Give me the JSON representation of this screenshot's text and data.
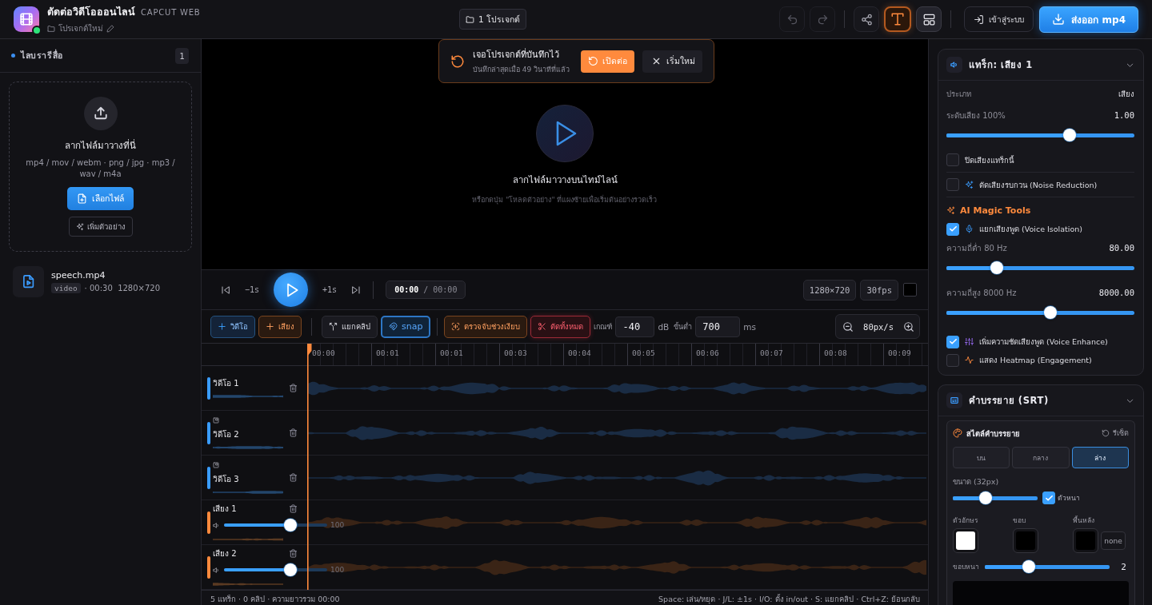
{
  "app": {
    "title": "ตัดต่อวิดีโอออนไลน์",
    "subtitle": "CAPCUT WEB",
    "project_name": "โปรเจกต์ใหม่",
    "online": true
  },
  "projects_button": "1 โปรเจกต์",
  "header_tools": [
    {
      "disabled": true,
      "selected": false,
      "pressed": false
    },
    {
      "disabled": true,
      "selected": false,
      "pressed": false
    },
    {
      "disabled": false,
      "selected": false,
      "pressed": false
    },
    {
      "disabled": false,
      "selected": true,
      "pressed": false
    },
    {
      "disabled": false,
      "selected": false,
      "pressed": true
    }
  ],
  "login_button": "เข้าสู่ระบบ",
  "export_button": "ส่งออก mp4",
  "library": {
    "title": "ไลบรารีสื่อ",
    "count": "1",
    "dropzone": {
      "title": "ลากไฟล์มาวางที่นี่",
      "formats": "mp4 / mov / webm · png / jpg · mp3 / wav / m4a",
      "choose_button": "เลือกไฟล์",
      "sample_button": "เพิ่มตัวอย่าง"
    },
    "items": [
      {
        "name": "speech.mp4",
        "type": "video",
        "details": "· 00:30  1280×720"
      }
    ]
  },
  "restore_banner": {
    "title": "เจอโปรเจกต์ที่บันทึกไว้",
    "subtitle": "บันทึกล่าสุดเมื่อ 49 วินาทีที่แล้ว",
    "resume_button": "เปิดต่อ",
    "new_button": "เริ่มใหม่"
  },
  "preview": {
    "title": "ลากไฟล์มาวางบนไทม์ไลน์",
    "hint": "หรือกดปุ่ม \"โหลดตัวอย่าง\" ที่แผงซ้ายเพื่อเริ่มต้นอย่างรวดเร็ว"
  },
  "transport": {
    "back": "−1s",
    "forward": "+1s",
    "time": "**00:00** / 00:00",
    "resolution": "1280×720",
    "fps": "30fps"
  },
  "toolbar": {
    "add_video": "วิดีโอ",
    "add_audio": "เสียง",
    "split": "แยกคลิป",
    "snap": {
      "label": "snap",
      "on": true
    },
    "detect_silence": "ตรวจจับช่วงเงียบ",
    "cut_all": "ตัดทั้งหมด",
    "threshold_label": "เกณฑ์",
    "threshold": "-40",
    "threshold_unit": "dB",
    "min_label": "ขั้นต่ำ",
    "min_duration": "700",
    "min_unit": "ms",
    "zoom": "80px/s"
  },
  "ruler": [
    "00:00",
    "00:01",
    "00:01",
    "00:03",
    "00:04",
    "00:05",
    "00:06",
    "00:07",
    "00:08",
    "00:09"
  ],
  "tracks": [
    {
      "kind": "video",
      "name": "วิดีโอ 1",
      "overlay": false
    },
    {
      "kind": "video",
      "name": "วิดีโอ 2",
      "overlay": true
    },
    {
      "kind": "video",
      "name": "วิดีโอ 3",
      "overlay": true
    },
    {
      "kind": "audio",
      "name": "เสียง 1",
      "overlay": false,
      "level": 0.64,
      "volume": "100"
    },
    {
      "kind": "audio",
      "name": "เสียง 2",
      "overlay": false,
      "level": 0.64,
      "volume": "100"
    }
  ],
  "status_bar": {
    "summary": "5 แทร็ก · 0 คลิป · ความยาวรวม 00:00",
    "shortcuts": "Space: เล่น/หยุด · J/L: ±1s · I/O: ตั้ง in/out · S: แยกคลิป · Ctrl+Z: ย้อนกลับ"
  },
  "track_panel": {
    "title": "แทร็ก: เสียง 1",
    "rows": [
      {
        "kind": "field",
        "label": "ประเภท",
        "value": "เสียง"
      },
      {
        "kind": "slider",
        "label": "ระดับเสียง 100%",
        "value": "1.00",
        "level": 0.655
      },
      {
        "kind": "checkbox",
        "label": "ปิดเสียงแทร็กนี้",
        "checked": false
      },
      {
        "kind": "checkbox",
        "label": "ตัดเสียงรบกวน (Noise Reduction)",
        "checked": false
      },
      {
        "kind": "heading",
        "label": "AI Magic Tools"
      },
      {
        "kind": "checkbox",
        "label": "แยกเสียงพูด (Voice Isolation)",
        "checked": true
      },
      {
        "kind": "slider",
        "label": "ความถี่ต่ำ 80 Hz",
        "value": "80.00",
        "level": 0.27
      },
      {
        "kind": "slider",
        "label": "ความถี่สูง 8000 Hz",
        "value": "8000.00",
        "level": 0.555
      },
      {
        "kind": "checkbox",
        "label": "เพิ่มความชัดเสียงพูด (Voice Enhance)",
        "checked": true
      },
      {
        "kind": "checkbox",
        "label": "แสดง Heatmap (Engagement)",
        "checked": false
      }
    ]
  },
  "subtitle_panel": {
    "title": "คำบรรยาย (SRT)",
    "style_title": "สไตล์คำบรรยาย",
    "reset": "รีเซ็ต",
    "positions": [
      {
        "label": "บน",
        "selected": false
      },
      {
        "label": "กลาง",
        "selected": false
      },
      {
        "label": "ล่าง",
        "selected": true
      }
    ],
    "size": {
      "label": "ขนาด (32px)",
      "level": 0.39
    },
    "bold": {
      "label": "ตัวหนา",
      "checked": true
    },
    "colors": [
      {
        "label": "ตัวอักษร",
        "color": "#ffffff"
      },
      {
        "label": "ขอบ",
        "color": "#000000"
      },
      {
        "label": "พื้นหลัง",
        "color": "#000000"
      }
    ],
    "background_none": "none",
    "outline": {
      "label": "ขอบหนา",
      "level": 0.35,
      "value": "2"
    }
  }
}
